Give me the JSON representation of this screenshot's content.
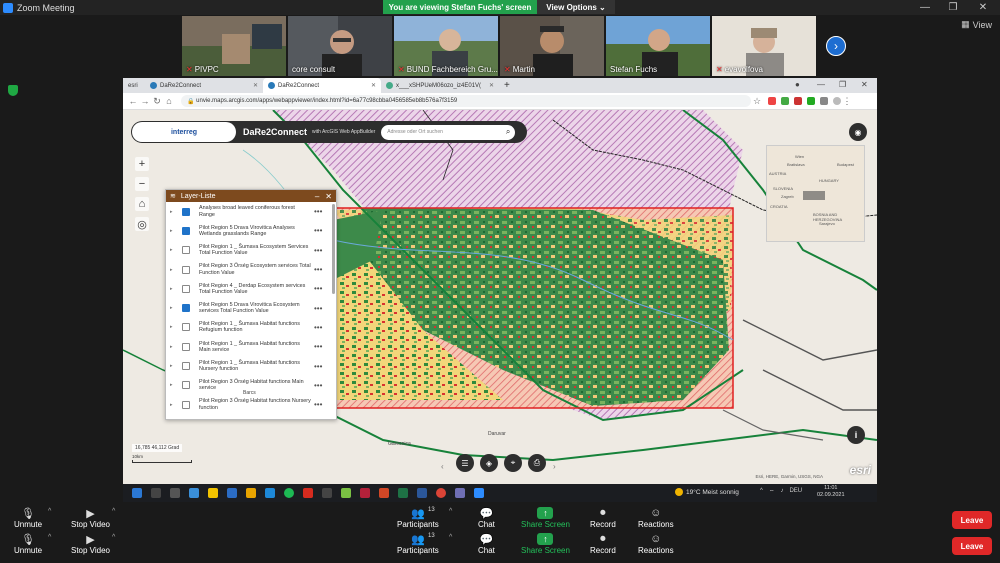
{
  "window": {
    "title": "Zoom Meeting",
    "min": "—",
    "max": "❐",
    "close": "✕"
  },
  "banner": {
    "viewing": "You are viewing Stefan Fuchs' screen",
    "options": "View Options ⌄"
  },
  "view_label": "View",
  "participants": [
    {
      "name": "PIVPC",
      "muted": true,
      "bg": "#6d6459"
    },
    {
      "name": "core consult",
      "muted": false,
      "bg": "#3e4146"
    },
    {
      "name": "BUND Fachbereich Gru...",
      "muted": true,
      "bg": "#6f8c5a"
    },
    {
      "name": "Martin",
      "muted": true,
      "bg": "#5a5148"
    },
    {
      "name": "Stefan Fuchs",
      "muted": false,
      "bg": "#4d83b5"
    },
    {
      "name": "evavolfova",
      "muted": true,
      "bg": "#d8d4cc"
    }
  ],
  "browser": {
    "tabs": [
      {
        "label": "esri",
        "active": false
      },
      {
        "label": "DaRe2Connect",
        "active": false
      },
      {
        "label": "DaRe2Connect",
        "active": true
      },
      {
        "label": "x___xSHPUeM06ozo_iz4E01V(",
        "active": false
      }
    ],
    "url": "unvie.maps.arcgis.com/apps/webappviewer/index.html?id=6a77c98cbba0456585eb8b576a7f3159"
  },
  "app": {
    "logo": "interreg",
    "title": "DaRe2Connect",
    "subtitle": "with ArcGIS Web AppBuilder",
    "search_placeholder": "Adresse oder Ort suchen"
  },
  "overview_labels": [
    "Wien",
    "Bratislava",
    "Budapest",
    "AUSTRIA",
    "HUNGARY",
    "SLOVENIA",
    "Zagreb",
    "CROATIA",
    "BOSNIA AND HERZEGOVINA",
    "Sarajevo"
  ],
  "layer_panel": {
    "title": "Layer-Liste",
    "items": [
      {
        "label": "Analyses broad leaved coniferous forest Range",
        "checked": true
      },
      {
        "label": "Pilot Region 5 Drava Virovitica Analyses Wetlands grasslands Range",
        "checked": true
      },
      {
        "label": "Pilot Region 1 _ Šumava Ecosystem Services Total Function Value",
        "checked": false
      },
      {
        "label": "Pilot Region 3 Őrség Ecosystem services Total Function Value",
        "checked": false
      },
      {
        "label": "Pilot Region 4 _ Derdap Ecosystem services Total Function Value",
        "checked": false
      },
      {
        "label": "Pilot Region 5 Drava Virovitica Ecosystem services Total Function Value",
        "checked": true
      },
      {
        "label": "Pilot Region 1 _ Šumava Habitat functions Refugium function",
        "checked": false
      },
      {
        "label": "Pilot Region 1 _ Šumava Habitat functions Main service",
        "checked": false
      },
      {
        "label": "Pilot Region 1 _ Šumava Habitat functions Nursery function",
        "checked": false
      },
      {
        "label": "Pilot Region 3 Őrség Habitat functions Main service",
        "checked": false
      },
      {
        "label": "Pilot Region 3 Őrség Habitat functions Nursery function",
        "checked": false
      },
      {
        "label": "Pilot Region 3 Őrség Habitat functions",
        "checked": false
      }
    ]
  },
  "map": {
    "coordinates": "16,785 46,112 Grad",
    "scale": "10km",
    "places": [
      "Barcs",
      "Daruvar",
      "Garesnica"
    ],
    "attribution": "Esri, HERE, Garmin, USGS, NGA",
    "esri": "esri"
  },
  "taskbar": {
    "weather": "19°C  Meist sonnig",
    "lang": "DEU",
    "time": "11:01",
    "date": "02.09.2021"
  },
  "controls": {
    "unmute": "Unmute",
    "stop_video": "Stop Video",
    "participants": "Participants",
    "participant_count": "13",
    "chat": "Chat",
    "share": "Share Screen",
    "record": "Record",
    "reactions": "Reactions",
    "leave": "Leave"
  }
}
